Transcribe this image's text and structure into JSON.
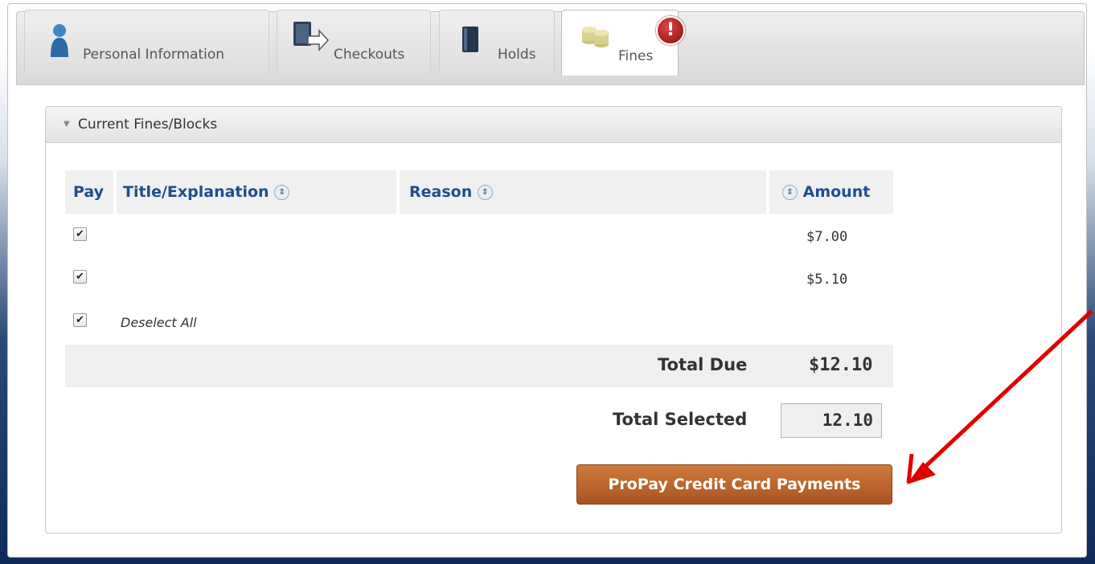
{
  "tabs": [
    {
      "label": "Personal Information",
      "icon": "person-icon"
    },
    {
      "label": "Checkouts",
      "icon": "checkouts-icon"
    },
    {
      "label": "Holds",
      "icon": "book-icon"
    },
    {
      "label": "Fines",
      "icon": "coins-icon",
      "active": true
    }
  ],
  "alert_badge": "!",
  "section": {
    "title": "Current Fines/Blocks"
  },
  "table": {
    "headers": {
      "pay": "Pay",
      "title": "Title/Explanation",
      "reason": "Reason",
      "amount": "Amount"
    },
    "rows": [
      {
        "checked": true,
        "amount": "$7.00"
      },
      {
        "checked": true,
        "amount": "$5.10"
      }
    ],
    "deselect_all": "Deselect All"
  },
  "totals": {
    "due_label": "Total Due",
    "due_value": "$12.10",
    "selected_label": "Total Selected",
    "selected_value": "12.10"
  },
  "pay_button": "ProPay Credit Card Payments",
  "colors": {
    "accent_button": "#b9612b",
    "header_text": "#1f4e8c",
    "annotation_arrow": "#e00000"
  }
}
